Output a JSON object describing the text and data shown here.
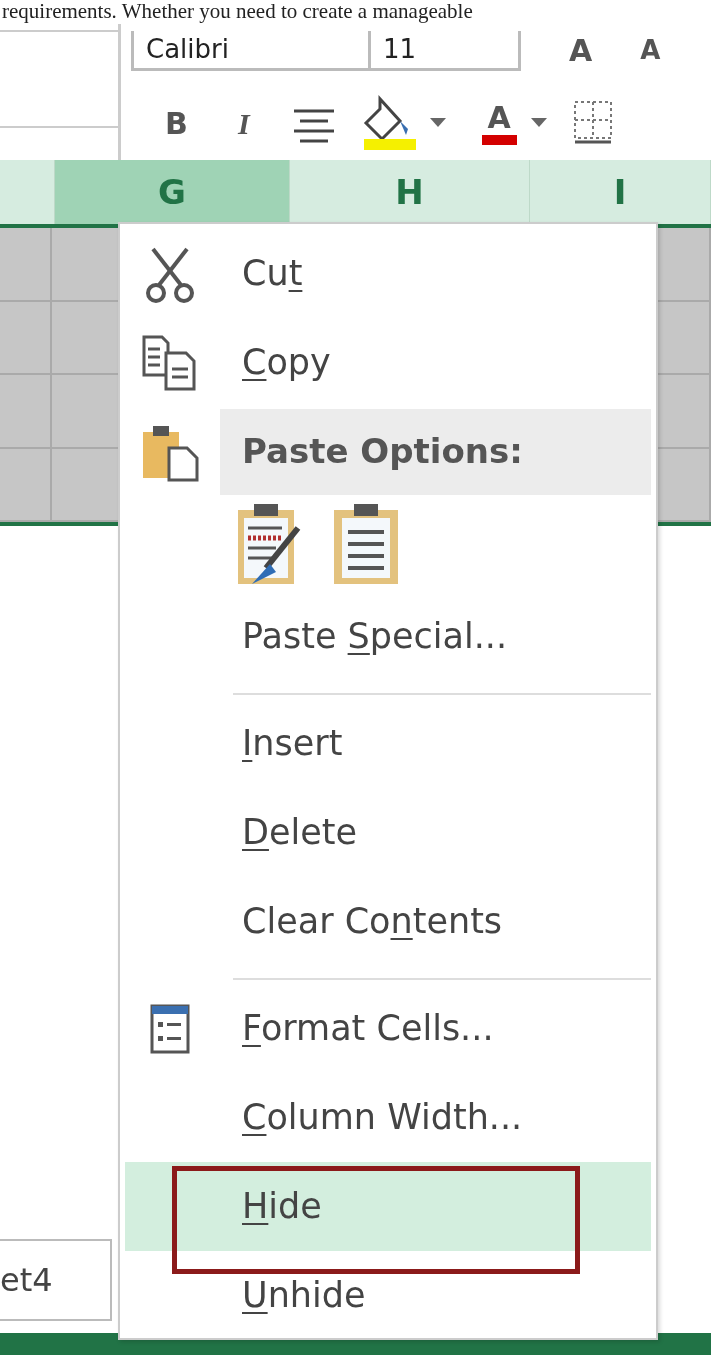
{
  "article_text": "requirements. Whether you need to create a manageable",
  "toolbar": {
    "font_name": "Calibri",
    "font_size": "11",
    "grow_label": "A",
    "shrink_label": "A",
    "bold_label": "B",
    "italic_label": "I",
    "font_color_label": "A"
  },
  "columns": [
    {
      "label": "G",
      "selected": true
    },
    {
      "label": "H",
      "selected": false
    },
    {
      "label": "I",
      "selected": false
    }
  ],
  "sheet_tab": {
    "label": "et4"
  },
  "context_menu": [
    {
      "kind": "cut",
      "before": "Cu",
      "key": "t",
      "highlighted": false,
      "outlined": false
    },
    {
      "kind": "copy",
      "key": "C",
      "after": "opy",
      "highlighted": false,
      "outlined": false
    },
    {
      "kind": "paste_header",
      "before": "Paste Options:"
    },
    {
      "kind": "paste_icons"
    },
    {
      "kind": "command",
      "before": "Paste ",
      "key": "S",
      "after": "pecial...",
      "highlighted": false,
      "outlined": false
    },
    {
      "kind": "separator"
    },
    {
      "kind": "command",
      "key": "I",
      "after": "nsert",
      "highlighted": false,
      "outlined": false
    },
    {
      "kind": "command",
      "key": "D",
      "after": "elete",
      "highlighted": false,
      "outlined": false
    },
    {
      "kind": "command",
      "before": "Clear Co",
      "key": "n",
      "after": "tents",
      "highlighted": false,
      "outlined": false
    },
    {
      "kind": "separator"
    },
    {
      "kind": "format",
      "key": "F",
      "after": "ormat Cells...",
      "highlighted": false,
      "outlined": false
    },
    {
      "kind": "command",
      "key": "C",
      "after": "olumn Width...",
      "highlighted": false,
      "outlined": false
    },
    {
      "kind": "command",
      "key": "H",
      "after": "ide",
      "highlighted": true,
      "outlined": true
    },
    {
      "kind": "command",
      "key": "U",
      "after": "nhide",
      "highlighted": false,
      "outlined": false
    }
  ]
}
